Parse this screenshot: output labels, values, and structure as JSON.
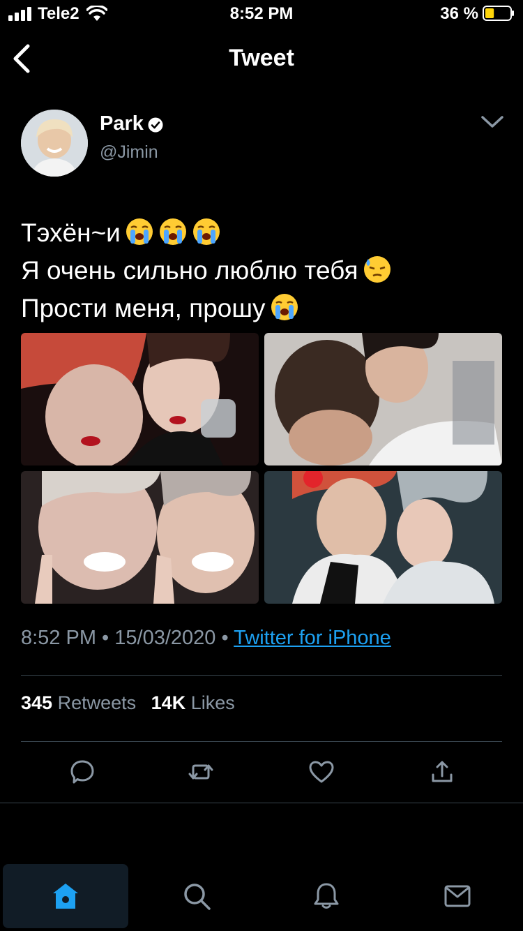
{
  "status_bar": {
    "carrier": "Tele2",
    "time": "8:52 PM",
    "battery_percent": "36 %",
    "battery_level": 0.36
  },
  "nav": {
    "title": "Tweet"
  },
  "author": {
    "name": "Park",
    "handle": "@Jimin",
    "verified": true
  },
  "tweet": {
    "lines": [
      "Тэхён~и",
      "Я очень сильно люблю тебя",
      "Прости меня, прошу"
    ],
    "timestamp": "8:52 PM • 15/03/2020 • ",
    "source": "Twitter for iPhone"
  },
  "stats": {
    "retweets_count": "345",
    "retweets_label": "Retweets",
    "likes_count": "14K",
    "likes_label": "Likes"
  },
  "colors": {
    "accent": "#1da1f2",
    "muted": "#8b98a5",
    "divider": "#38444d"
  },
  "icons": [
    "chevron-left-icon",
    "verified-badge-icon",
    "chevron-down-icon",
    "reply-icon",
    "retweet-icon",
    "like-icon",
    "share-icon",
    "home-icon",
    "search-icon",
    "notifications-icon",
    "messages-icon"
  ]
}
